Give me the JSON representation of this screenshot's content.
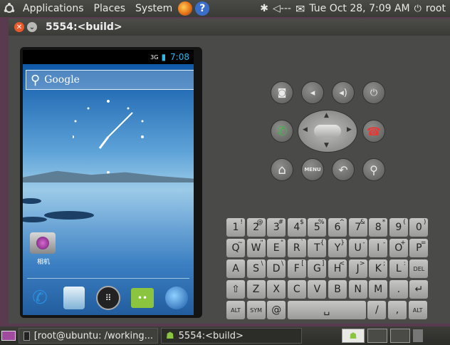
{
  "top_panel": {
    "applications": "Applications",
    "places": "Places",
    "system": "System",
    "bluetooth_glyph": "✱",
    "volume_glyph": "◁---",
    "mail_glyph": "✉",
    "datetime": "Tue Oct 28,  7:09 AM",
    "user": "root"
  },
  "window": {
    "title": "5554:<build>",
    "close_glyph": "✕",
    "min_glyph": "⌄"
  },
  "phone": {
    "signal": "3G",
    "battery": "▮",
    "clock": "7:08",
    "search_label": "Google",
    "app_label": "相机",
    "search_glyph": "⚲"
  },
  "controls": {
    "camera": "◙",
    "vol_down": "◂",
    "vol_up": "◂)",
    "power": "⏻",
    "call": "✆",
    "end": "☎",
    "home": "⌂",
    "menu": "MENU",
    "back": "↶",
    "search": "⚲"
  },
  "keyboard": {
    "row1": [
      {
        "main": "1",
        "alt": "!"
      },
      {
        "main": "2",
        "alt": "@"
      },
      {
        "main": "3",
        "alt": "#"
      },
      {
        "main": "4",
        "alt": "$"
      },
      {
        "main": "5",
        "alt": "%"
      },
      {
        "main": "6",
        "alt": "^"
      },
      {
        "main": "7",
        "alt": "&"
      },
      {
        "main": "8",
        "alt": "*"
      },
      {
        "main": "9",
        "alt": "("
      },
      {
        "main": "0",
        "alt": ")"
      }
    ],
    "row2": [
      {
        "main": "Q",
        "alt": "~"
      },
      {
        "main": "W",
        "alt": "\""
      },
      {
        "main": "E",
        "alt": "\""
      },
      {
        "main": "R",
        "alt": "`"
      },
      {
        "main": "T",
        "alt": "{"
      },
      {
        "main": "Y",
        "alt": "}"
      },
      {
        "main": "U",
        "alt": "-"
      },
      {
        "main": "I",
        "alt": "-"
      },
      {
        "main": "O",
        "alt": "+"
      },
      {
        "main": "P",
        "alt": "="
      }
    ],
    "row3": [
      {
        "main": "A",
        "alt": ""
      },
      {
        "main": "S",
        "alt": "\\"
      },
      {
        "main": "D",
        "alt": "\\"
      },
      {
        "main": "F",
        "alt": "["
      },
      {
        "main": "G",
        "alt": "]"
      },
      {
        "main": "H",
        "alt": "<"
      },
      {
        "main": "J",
        "alt": ">"
      },
      {
        "main": "K",
        "alt": ";"
      },
      {
        "main": "L",
        "alt": ":"
      },
      {
        "main": "DEL",
        "alt": ""
      }
    ],
    "row4": [
      {
        "main": "⇧",
        "alt": ""
      },
      {
        "main": "Z",
        "alt": ""
      },
      {
        "main": "X",
        "alt": ""
      },
      {
        "main": "C",
        "alt": ""
      },
      {
        "main": "V",
        "alt": ""
      },
      {
        "main": "B",
        "alt": ""
      },
      {
        "main": "N",
        "alt": ""
      },
      {
        "main": "M",
        "alt": ""
      },
      {
        "main": ".",
        "alt": ""
      },
      {
        "main": "↵",
        "alt": ""
      }
    ],
    "row5": [
      {
        "main": "ALT",
        "alt": ""
      },
      {
        "main": "SYM",
        "alt": ""
      },
      {
        "main": "@",
        "alt": ""
      },
      {
        "main": "␣",
        "alt": ""
      },
      {
        "main": "/",
        "alt": ""
      },
      {
        "main": ",",
        "alt": ""
      },
      {
        "main": "ALT",
        "alt": ""
      }
    ]
  },
  "bottom_panel": {
    "task1": "[root@ubuntu: /working...",
    "task2": "5554:<build>"
  },
  "colors": {
    "accent_blue": "#33b5e5",
    "ubuntu_orange": "#e95a2a"
  }
}
